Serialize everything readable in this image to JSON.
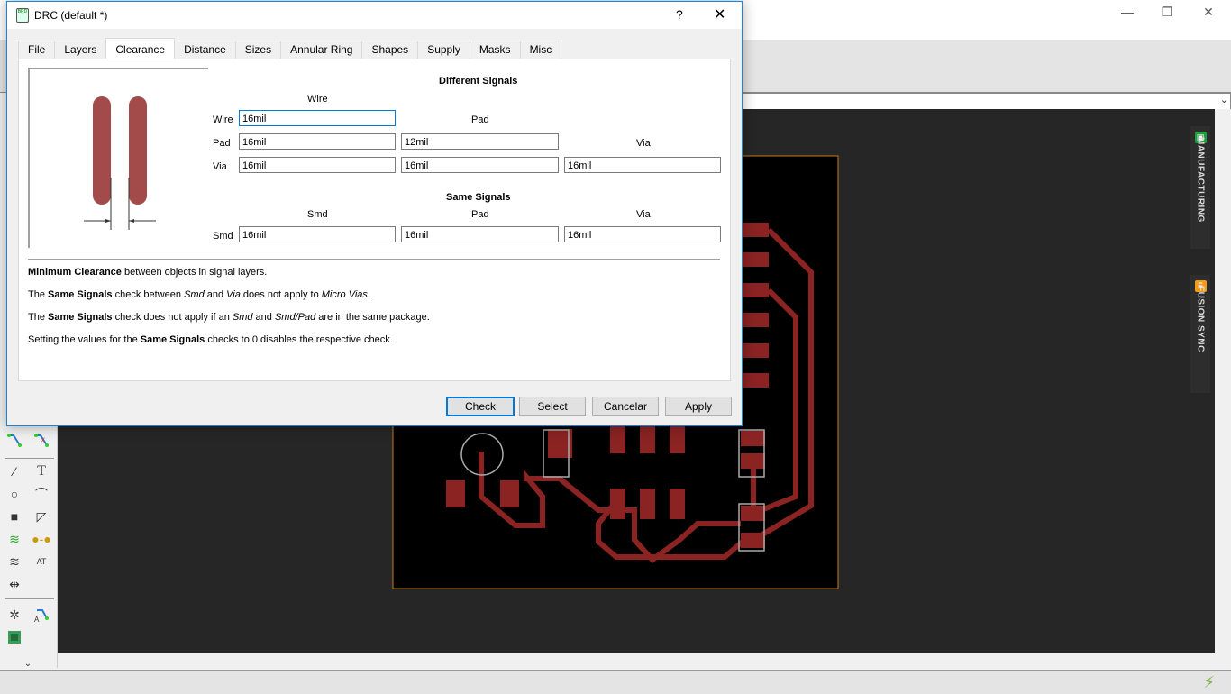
{
  "app": {
    "window_controls": {
      "minimize": "—",
      "restore": "❐",
      "close": "✕"
    },
    "side_panels": [
      {
        "label": "MANUFACTURING",
        "icon": "manufacturing-icon",
        "color": "#1e9e3e"
      },
      {
        "label": "FUSION SYNC",
        "icon": "fusion-icon",
        "icon_text": "F",
        "color": "#f39c12"
      }
    ],
    "status_icon": "lightning-bolt-icon"
  },
  "dialog": {
    "title": "DRC (default *)",
    "help": "?",
    "close": "✕",
    "tabs": [
      {
        "label": "File",
        "active": false
      },
      {
        "label": "Layers",
        "active": false
      },
      {
        "label": "Clearance",
        "active": true
      },
      {
        "label": "Distance",
        "active": false
      },
      {
        "label": "Sizes",
        "active": false
      },
      {
        "label": "Annular Ring",
        "active": false
      },
      {
        "label": "Shapes",
        "active": false
      },
      {
        "label": "Supply",
        "active": false
      },
      {
        "label": "Masks",
        "active": false
      },
      {
        "label": "Misc",
        "active": false
      }
    ],
    "different_signals": {
      "title": "Different Signals",
      "col_wire": "Wire",
      "col_pad": "Pad",
      "col_via": "Via",
      "rows": [
        {
          "label": "Wire",
          "wire": "16mil"
        },
        {
          "label": "Pad",
          "wire": "16mil",
          "pad": "12mil"
        },
        {
          "label": "Via",
          "wire": "16mil",
          "pad": "16mil",
          "via": "16mil"
        }
      ]
    },
    "same_signals": {
      "title": "Same Signals",
      "col_smd": "Smd",
      "col_pad": "Pad",
      "col_via": "Via",
      "row_label": "Smd",
      "smd": "16mil",
      "pad": "16mil",
      "via": "16mil"
    },
    "notes": {
      "n1_bold": "Minimum Clearance",
      "n1_rest": " between objects in signal layers.",
      "n2_a": "The ",
      "n2_bold": "Same Signals",
      "n2_b": " check between ",
      "n2_i1": "Smd",
      "n2_c": " and ",
      "n2_i2": "Via",
      "n2_d": " does not apply to ",
      "n2_i3": "Micro Vias",
      "n2_e": ".",
      "n3_a": "The ",
      "n3_bold": "Same Signals",
      "n3_b": " check does not apply if an ",
      "n3_i1": "Smd",
      "n3_c": " and ",
      "n3_i2": "Smd/Pad",
      "n3_d": " are in the same package.",
      "n4_a": "Setting the values for the ",
      "n4_bold": "Same Signals",
      "n4_b": " checks to 0 disables the respective check."
    },
    "buttons": {
      "check": "Check",
      "select": "Select",
      "cancel": "Cancelar",
      "apply": "Apply"
    }
  }
}
